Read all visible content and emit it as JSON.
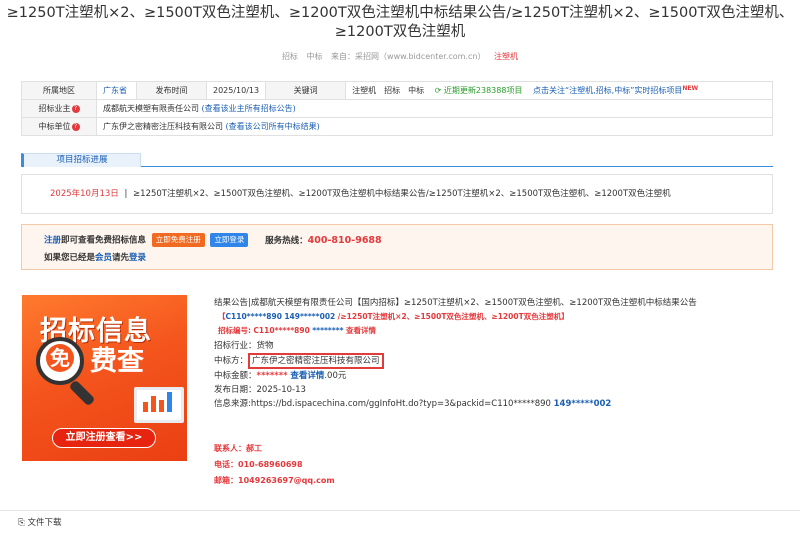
{
  "page_title": "≥1250T注塑机×2、≥1500T双色注塑机、≥1200T双色注塑机中标结果公告/≥1250T注塑机×2、≥1500T双色注塑机、≥1200T双色注塑机",
  "meta": {
    "tag1": "招标",
    "tag2": "中标",
    "source": "来自：采招网（www.bidcenter.com.cn）",
    "keyword": "注塑机"
  },
  "info_table": {
    "region_label": "所属地区",
    "region_value": "广东省",
    "publish_label": "发布时间",
    "publish_value": "2025/10/13",
    "keywords_label": "关键词",
    "keywords_value": "注塑机　招标　中标",
    "recent_updates": "近期更新238388项目",
    "follow_text": "点击关注“注塑机,招标,中标”实时招标项目",
    "new_badge": "NEW",
    "owner_label": "招标业主",
    "owner_value": "成都航天模塑有限责任公司",
    "owner_link": "(查看该业主所有招标公告)",
    "winner_label": "中标单位",
    "winner_value": "广东伊之密精密注压科技有限公司",
    "winner_link": "(查看该公司所有中标结果)"
  },
  "progress_tab": "项目招标进展",
  "progress_item": {
    "date": "2025年10月13日",
    "separator": "|",
    "text": "≥1250T注塑机×2、≥1500T双色注塑机、≥1200T双色注塑机中标结果公告/≥1250T注塑机×2、≥1500T双色注塑机、≥1200T双色注塑机"
  },
  "notice": {
    "register_link": "注册",
    "line1_text": "即可查看免费招标信息",
    "register_button": "立即免费注册",
    "login_button": "立即登录",
    "hotline_label": "服务热线：",
    "hotline_number": "400-810-9688",
    "line2_prefix": "如果您已经是",
    "member_link": "会员",
    "line2_mid": "请先",
    "login_link": "登录"
  },
  "banner": {
    "title1": "招标信息",
    "title2": "费查",
    "mian": "免",
    "button": "立即注册查看>>"
  },
  "details": {
    "line1": "结果公告|成都航天模塑有限责任公司【国内招标】≥1250T注塑机×2、≥1500T双色注塑机、≥1200T双色注塑机中标结果公告",
    "line2_open": "【",
    "line2_code": "C110*****890",
    "line2_mask": "149*****002",
    "line2_rest": "/≥1250T注塑机×2、≥1500T双色注塑机、≥1200T双色注塑机】",
    "line3_label": "招标编号:",
    "line3_code": "C110*****890",
    "line3_mask": "********",
    "line3_link": "查看详情",
    "industry": "招标行业：货物",
    "winner_label": "中标方：",
    "winner_value": "广东伊之密精密注压科技有限公司",
    "amount_label": "中标金额：",
    "amount_mask": "*******",
    "amount_link": "查看详情",
    "amount_unit": ".00元",
    "date": "发布日期：2025-10-13",
    "source_prefix": "信息来源:https://bd.ispacechina.com/ggInfoHt.do?typ=3&packid=",
    "source_code": "C110*****890",
    "source_mask": "149*****002"
  },
  "contact": {
    "person": "联系人：郝工",
    "phone": "电话：010-68960698",
    "email": "邮箱：1049263697@qq.com"
  },
  "footer": {
    "label": "文件下载"
  }
}
